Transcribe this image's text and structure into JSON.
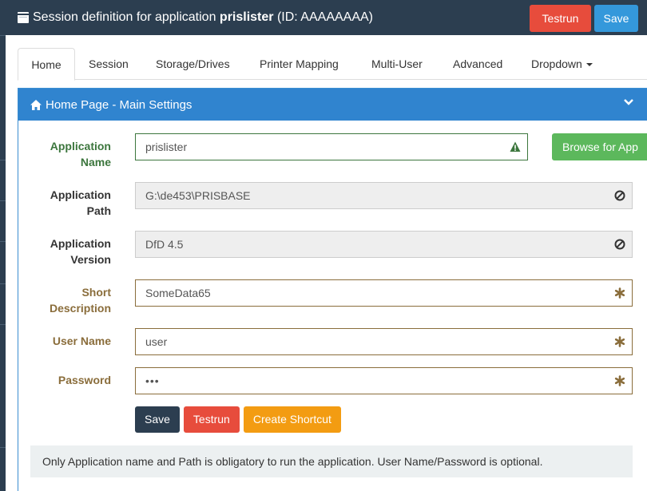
{
  "header": {
    "title_prefix": "Session definition for application ",
    "app_name": "prislister",
    "title_suffix": " (ID: AAAAAAAA)",
    "testrun_label": "Testrun",
    "save_label": "Save"
  },
  "tabs": [
    {
      "label": "Home",
      "active": true
    },
    {
      "label": "Session",
      "active": false
    },
    {
      "label": "Storage/Drives",
      "active": false
    },
    {
      "label": "Printer Mapping",
      "active": false
    },
    {
      "label": "Multi-User",
      "active": false
    },
    {
      "label": "Advanced",
      "active": false
    },
    {
      "label": "Dropdown",
      "active": false
    }
  ],
  "panel": {
    "title": "Home Page - Main Settings",
    "icon": "home-icon",
    "collapse_icon": "chevron-down-icon"
  },
  "form": {
    "app_name": {
      "label_line1": "Application",
      "label_line2": "Name",
      "value": "prislister",
      "state": "success",
      "icon": "warning-triangle-icon"
    },
    "browse_label": "Browse for App",
    "app_path": {
      "label_line1": "Application",
      "label_line2": "Path",
      "value": "G:\\de453\\PRISBASE",
      "state": "disabled",
      "icon": "ban-icon"
    },
    "app_version": {
      "label_line1": "Application",
      "label_line2": "Version",
      "value": "DfD 4.5",
      "state": "disabled",
      "icon": "ban-icon"
    },
    "short_desc": {
      "label_line1": "Short",
      "label_line2": "Description",
      "value": "SomeData65",
      "state": "required",
      "icon": "asterisk-icon"
    },
    "user_name": {
      "label": "User Name",
      "value": "user",
      "state": "required",
      "icon": "asterisk-icon"
    },
    "password": {
      "label": "Password",
      "value": "•••",
      "state": "required",
      "icon": "asterisk-icon"
    }
  },
  "actions": {
    "save_label": "Save",
    "testrun_label": "Testrun",
    "create_shortcut_label": "Create Shortcut"
  },
  "info_text": "Only Application name and Path is obligatory to run the application. User Name/Password is optional.",
  "colors": {
    "header_bg": "#2c3e50",
    "panel_heading": "#3084cf",
    "danger": "#e74c3c",
    "primary": "#3498db",
    "warning": "#f39c12",
    "success": "#5cb85c",
    "success_text": "#3c763d",
    "warning_text": "#8a6d3b"
  }
}
